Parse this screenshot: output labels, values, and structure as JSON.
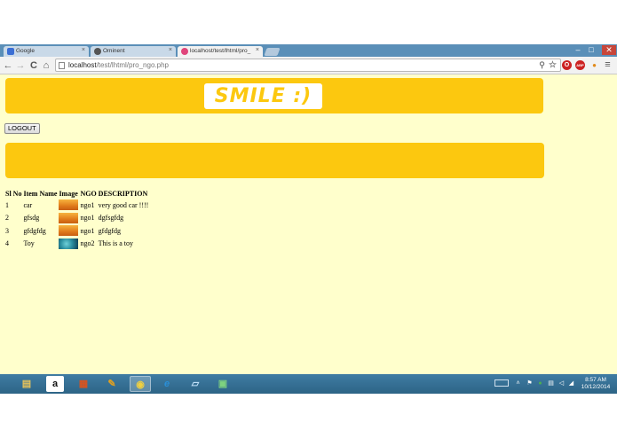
{
  "browser": {
    "tabs": [
      {
        "title": "Google",
        "favicon_color": "#3b6fd4",
        "active": false
      },
      {
        "title": "Ominent",
        "favicon_color": "#555555",
        "active": false
      },
      {
        "title": "localhost/test/lhtml/pro_",
        "favicon_color": "#e0457b",
        "active": true
      }
    ],
    "tab_close_glyph": "×",
    "window_controls": {
      "minimize": "–",
      "restore": "□",
      "close": "✕"
    },
    "nav": {
      "back": "←",
      "forward": "→",
      "reload": "C",
      "home": "⌂"
    },
    "url": {
      "host": "localhost",
      "path": "/test/lhtml/pro_ngo.php"
    },
    "toolbar_icons": [
      {
        "name": "key-icon",
        "glyph": "⚲",
        "color": "#777777"
      },
      {
        "name": "star-icon",
        "glyph": "☆",
        "color": "#777777"
      },
      {
        "name": "opera-extension-icon",
        "glyph": "O",
        "color": "#cc2222"
      },
      {
        "name": "adblock-icon",
        "glyph": "ABP",
        "color": "#cc2222"
      },
      {
        "name": "extension-icon",
        "glyph": "●",
        "color": "#e08a1a"
      },
      {
        "name": "menu-icon",
        "glyph": "≡",
        "color": "#555555"
      }
    ]
  },
  "page": {
    "background": "#ffffcc",
    "accent": "#fcc80f",
    "logo": "SMILE   :)",
    "logout_label": "LOGOUT",
    "table": {
      "headers": [
        "Sl No",
        "Item Name",
        "Image",
        "NGO",
        "DESCRIPTION"
      ],
      "rows": [
        {
          "sl": "1",
          "item": "car",
          "image": "orange",
          "ngo": "ngo1",
          "description": "very good car !!!!"
        },
        {
          "sl": "2",
          "item": "gfsdg",
          "image": "orange",
          "ngo": "ngo1",
          "description": "dgfsgfdg"
        },
        {
          "sl": "3",
          "item": "gfdgfdg",
          "image": "orange",
          "ngo": "ngo1",
          "description": "gfdgfdg"
        },
        {
          "sl": "4",
          "item": "Toy",
          "image": "toy",
          "ngo": "ngo2",
          "description": "This is a toy"
        }
      ]
    }
  },
  "taskbar": {
    "apps": [
      {
        "name": "file-explorer-icon",
        "glyph": "▤",
        "color": "#e8c35a",
        "active": false
      },
      {
        "name": "amazon-icon",
        "glyph": "a",
        "color": "#111111",
        "active": false
      },
      {
        "name": "store-icon",
        "glyph": "▦",
        "color": "#d9531e",
        "active": false
      },
      {
        "name": "paint-icon",
        "glyph": "✎",
        "color": "#e0a020",
        "active": false
      },
      {
        "name": "chrome-icon",
        "glyph": "◉",
        "color": "#3c9a3c",
        "active": true
      },
      {
        "name": "internet-explorer-icon",
        "glyph": "e",
        "color": "#2a8fd8",
        "active": false
      },
      {
        "name": "notes-icon",
        "glyph": "▱",
        "color": "#7fb0d8",
        "active": false
      },
      {
        "name": "photos-icon",
        "glyph": "▣",
        "color": "#4caf50",
        "active": false
      }
    ],
    "tray_icons": [
      "keyboard-icon",
      "chevron-up-icon",
      "flag-icon",
      "shield-icon",
      "network-icon",
      "volume-icon",
      "signal-icon"
    ],
    "clock": {
      "time": "8:57 AM",
      "date": "10/12/2014"
    }
  }
}
